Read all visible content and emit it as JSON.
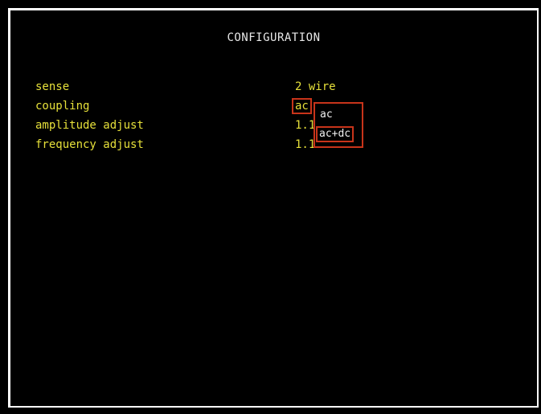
{
  "screen": {
    "title": "CONFIGURATION",
    "rows": [
      {
        "label": "sense",
        "value": "2 wire"
      },
      {
        "label": "coupling",
        "value": "ac"
      },
      {
        "label": "amplitude adjust",
        "value": "1.1000%"
      },
      {
        "label": "frequency adjust",
        "value": "1.1000%"
      }
    ]
  },
  "dropdown": {
    "options": [
      "ac",
      "ac+dc"
    ],
    "selected": "ac+dc"
  },
  "colors": {
    "background": "#000000",
    "label_text": "#e6e03a",
    "title_text": "#e8e8e8",
    "highlight_border": "#c8341a",
    "dropdown_text": "#f0f0f0"
  }
}
